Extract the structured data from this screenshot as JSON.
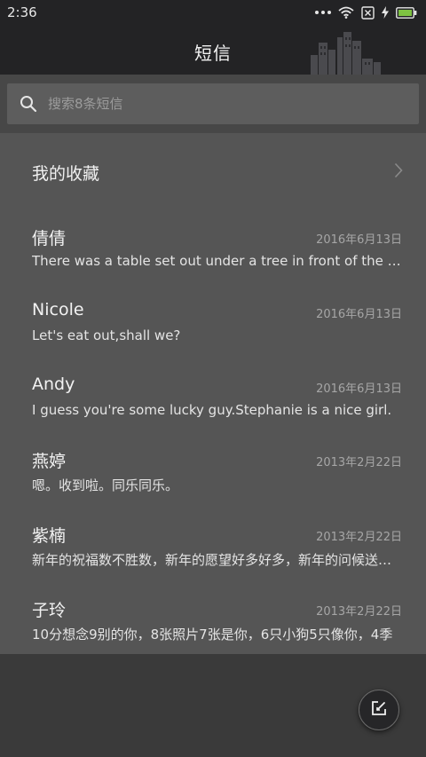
{
  "status_bar": {
    "time": "2:36"
  },
  "header": {
    "title": "短信"
  },
  "search": {
    "placeholder": "搜索8条短信"
  },
  "favorites": {
    "label": "我的收藏"
  },
  "messages": [
    {
      "name": "倩倩",
      "date": "2016年6月13日",
      "preview": "There was a table set out under a tree in front of the house"
    },
    {
      "name": "Nicole",
      "date": "2016年6月13日",
      "preview": "Let's eat out,shall we?"
    },
    {
      "name": "Andy",
      "date": "2016年6月13日",
      "preview": "I guess you're some lucky guy.Stephanie is a nice girl."
    },
    {
      "name": "燕婷",
      "date": "2013年2月22日",
      "preview": "嗯。收到啦。同乐同乐。"
    },
    {
      "name": "紫楠",
      "date": "2013年2月22日",
      "preview": "新年的祝福数不胜数，新年的愿望好多好多，新年的问候送给你"
    },
    {
      "name": "子玲",
      "date": "2013年2月22日",
      "preview": "10分想念9别的你，8张照片7张是你，6只小狗5只像你，4季"
    }
  ],
  "colors": {
    "header_bg": "#232325",
    "panel_bg": "#555555",
    "search_bg": "#5d5d5d",
    "battery_accent": "#7ec242"
  },
  "icons": {
    "search": "search-icon",
    "chevron": "chevron-right-icon",
    "compose": "compose-icon"
  }
}
